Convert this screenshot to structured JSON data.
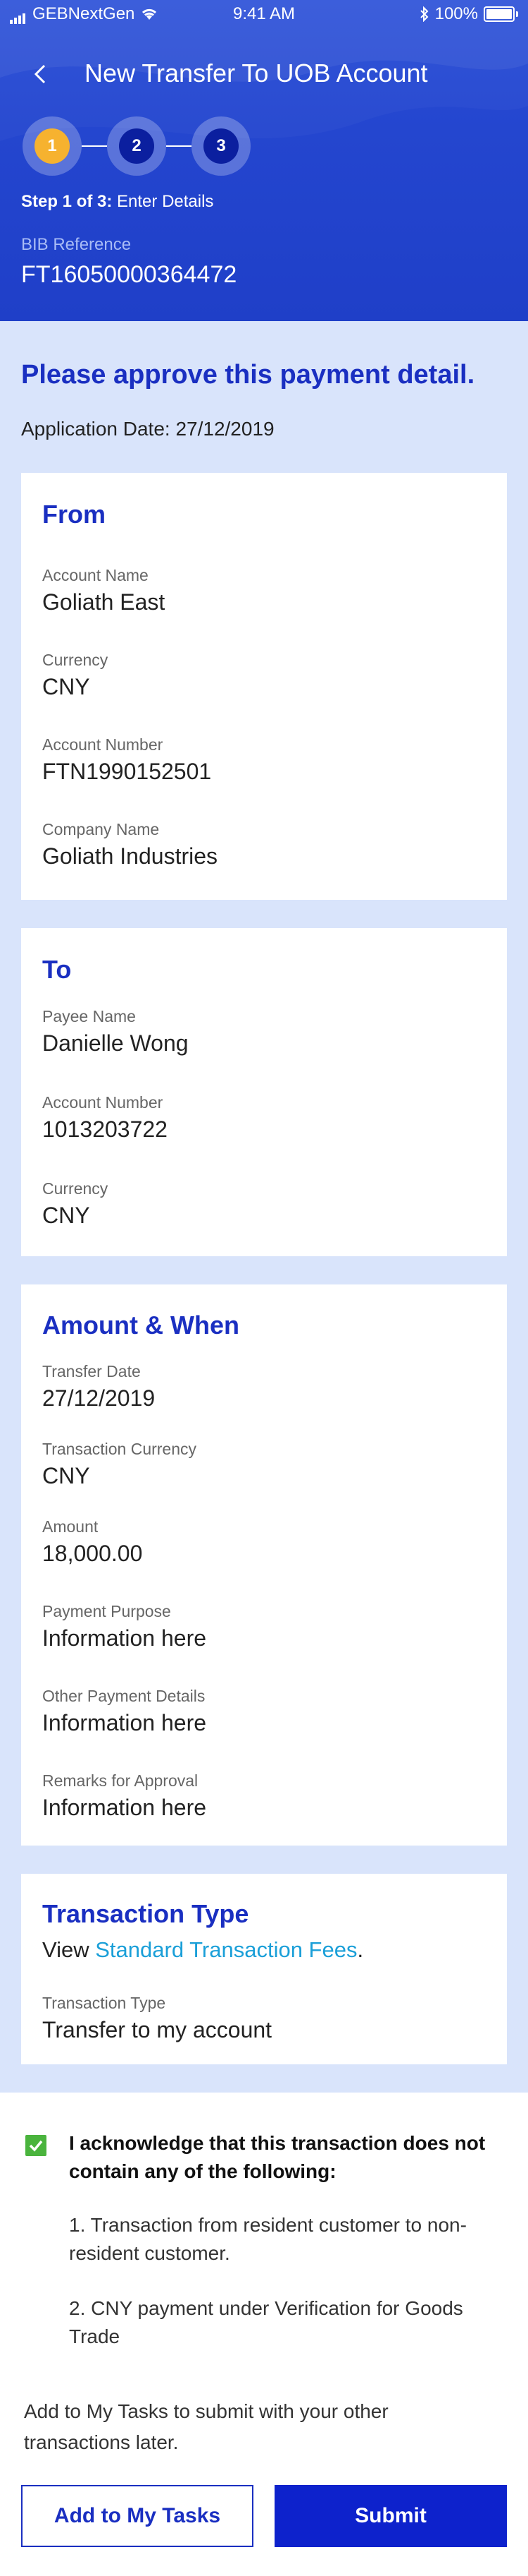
{
  "status_bar": {
    "carrier": "GEBNextGen",
    "time": "9:41 AM",
    "battery": "100%",
    "icons": [
      "signal-icon",
      "wifi-icon",
      "bluetooth-icon",
      "battery-icon"
    ]
  },
  "header": {
    "title": "New Transfer To UOB Account",
    "back_icon": "chevron-left-icon",
    "steps": [
      "1",
      "2",
      "3"
    ],
    "active_step": 1,
    "step_caption_prefix": "Step 1 of 3:",
    "step_caption_text": "Enter Details",
    "bib_label": "BIB Reference",
    "bib_value": "FT16050000364472"
  },
  "main": {
    "heading": "Please approve this payment detail.",
    "application_date": "Application Date: 27/12/2019"
  },
  "from_card": {
    "title": "From",
    "fields": [
      {
        "label": "Account Name",
        "value": "Goliath East"
      },
      {
        "label": "Currency",
        "value": "CNY"
      },
      {
        "label": "Account Number",
        "value": "FTN1990152501"
      },
      {
        "label": "Company Name",
        "value": "Goliath Industries"
      }
    ]
  },
  "to_card": {
    "title": "To",
    "fields": [
      {
        "label": "Payee Name",
        "value": "Danielle Wong"
      },
      {
        "label": "Account Number",
        "value": "1013203722"
      },
      {
        "label": "Currency",
        "value": "CNY"
      }
    ]
  },
  "amount_card": {
    "title": "Amount & When",
    "fields": [
      {
        "label": "Transfer Date",
        "value": "27/12/2019"
      },
      {
        "label": "Transaction Currency",
        "value": "CNY"
      },
      {
        "label": "Amount",
        "value": "18,000.00"
      },
      {
        "label": "Payment Purpose",
        "value": "Information here"
      },
      {
        "label": "Other Payment Details",
        "value": "Information here"
      },
      {
        "label": "Remarks for Approval",
        "value": "Information here"
      }
    ]
  },
  "type_card": {
    "title": "Transaction Type",
    "view_prefix": "View ",
    "fees_link": "Standard Transaction Fees",
    "view_suffix": ".",
    "field_label": "Transaction Type",
    "field_value": "Transfer to my account"
  },
  "footer": {
    "acknowledge": "I acknowledge that this transaction does not contain any of the following:",
    "items": [
      "1. Transaction from resident customer to non-resident customer.",
      "2. CNY payment under Verification for Goods Trade"
    ],
    "later_note": "Add to My Tasks to submit with your other transactions later.",
    "add_button": "Add to My Tasks",
    "submit_button": "Submit"
  },
  "colors": {
    "header_blue": "#2446cf",
    "accent_blue": "#1a2fc1",
    "active_step": "#f6b22f",
    "link": "#1a9fd8",
    "check_green": "#4ab43d",
    "page_bg": "#d9e4fb"
  }
}
